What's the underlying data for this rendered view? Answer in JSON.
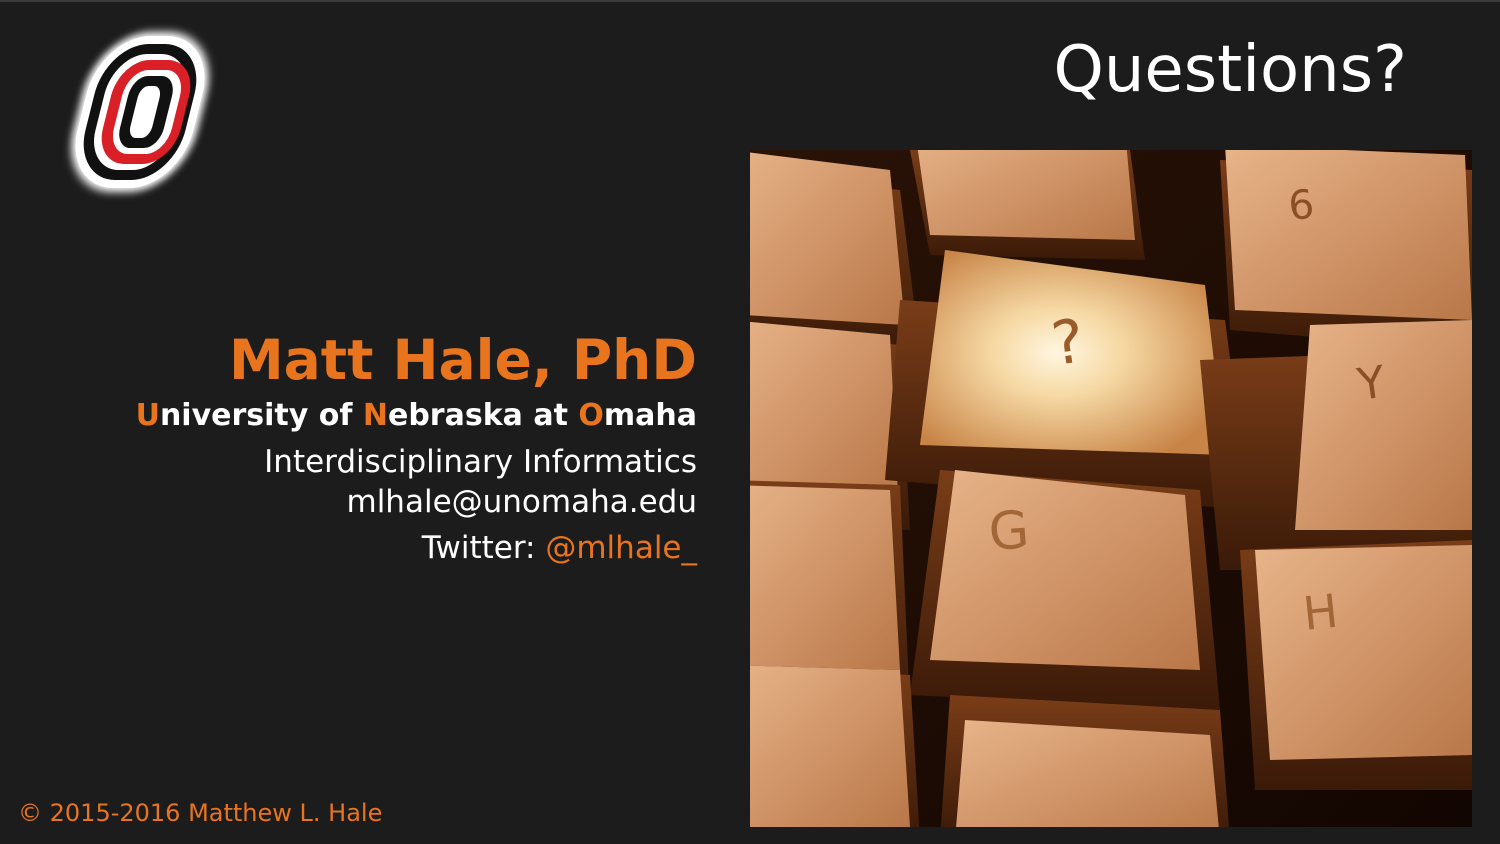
{
  "slide": {
    "title": "Questions?",
    "presenter": {
      "name": "Matt Hale, PhD",
      "university_parts": [
        {
          "text": "U",
          "highlight": true
        },
        {
          "text": "niversity of ",
          "highlight": false
        },
        {
          "text": "N",
          "highlight": true
        },
        {
          "text": "ebraska at ",
          "highlight": false
        },
        {
          "text": "O",
          "highlight": true
        },
        {
          "text": "maha",
          "highlight": false
        }
      ],
      "department": "Interdisciplinary Informatics",
      "email": "mlhale@unomaha.edu",
      "twitter_label": "Twitter: ",
      "twitter_handle": "@mlhale_"
    },
    "footer": "©  2015-2016 Matthew L. Hale",
    "image_keys": [
      "6",
      "?",
      "Y",
      "G",
      "H"
    ],
    "colors": {
      "background": "#1c1c1c",
      "accent": "#e8741e",
      "text": "#ffffff",
      "logo_red": "#d92027"
    },
    "logo_icon": "university-o-logo"
  }
}
